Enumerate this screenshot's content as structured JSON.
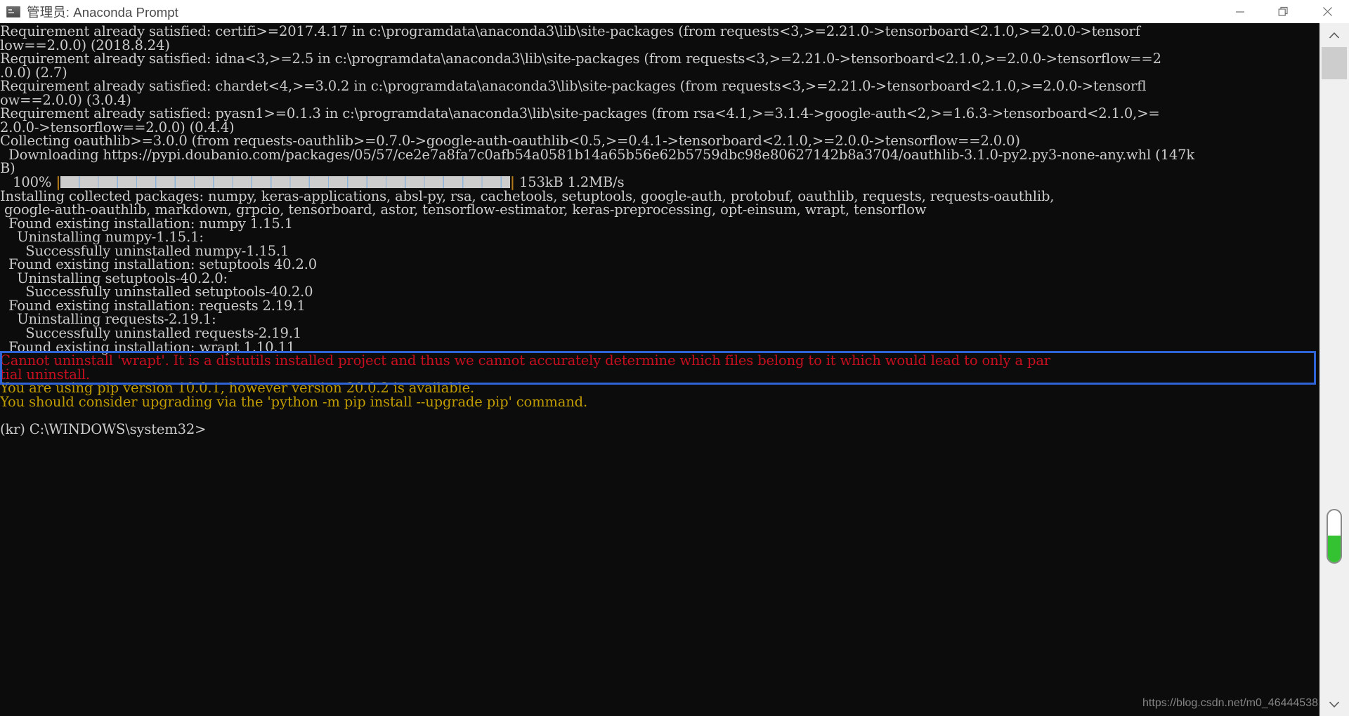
{
  "window": {
    "title": "管理员: Anaconda Prompt",
    "icon": "console-icon",
    "buttons": {
      "minimize": "minimize-icon",
      "maximize": "restore-icon",
      "close": "close-icon"
    }
  },
  "theme": {
    "background": "#0c0c0c",
    "foreground": "#cccccc",
    "red": "#c50f1f",
    "yellow": "#c19c00",
    "annotation": "#2f63d8",
    "scroll_thumb": "#35c232",
    "titlebar_bg": "#ffffff",
    "titlebar_fg": "#4a4a4a"
  },
  "console": {
    "lines": [
      {
        "id": "l01",
        "color": "white",
        "text": "Requirement already satisfied: certifi>=2017.4.17 in c:\\programdata\\anaconda3\\lib\\site-packages (from requests<3,>=2.21.0->tensorboard<2.1.0,>=2.0.0->tensorf"
      },
      {
        "id": "l02",
        "color": "white",
        "text": "low==2.0.0) (2018.8.24)"
      },
      {
        "id": "l03",
        "color": "white",
        "text": "Requirement already satisfied: idna<3,>=2.5 in c:\\programdata\\anaconda3\\lib\\site-packages (from requests<3,>=2.21.0->tensorboard<2.1.0,>=2.0.0->tensorflow==2"
      },
      {
        "id": "l04",
        "color": "white",
        "text": ".0.0) (2.7)"
      },
      {
        "id": "l05",
        "color": "white",
        "text": "Requirement already satisfied: chardet<4,>=3.0.2 in c:\\programdata\\anaconda3\\lib\\site-packages (from requests<3,>=2.21.0->tensorboard<2.1.0,>=2.0.0->tensorfl"
      },
      {
        "id": "l06",
        "color": "white",
        "text": "ow==2.0.0) (3.0.4)"
      },
      {
        "id": "l07",
        "color": "white",
        "text": "Requirement already satisfied: pyasn1>=0.1.3 in c:\\programdata\\anaconda3\\lib\\site-packages (from rsa<4.1,>=3.1.4->google-auth<2,>=1.6.3->tensorboard<2.1.0,>="
      },
      {
        "id": "l08",
        "color": "white",
        "text": "2.0.0->tensorflow==2.0.0) (0.4.4)"
      },
      {
        "id": "l09",
        "color": "white",
        "text": "Collecting oauthlib>=3.0.0 (from requests-oauthlib>=0.7.0->google-auth-oauthlib<0.5,>=0.4.1->tensorboard<2.1.0,>=2.0.0->tensorflow==2.0.0)"
      },
      {
        "id": "l10",
        "color": "white",
        "text": "  Downloading https://pypi.doubanio.com/packages/05/57/ce2e7a8fa7c0afb54a0581b14a65b56e62b5759dbc98e80627142b8a3704/oauthlib-3.1.0-py2.py3-none-any.whl (147k"
      },
      {
        "id": "l11",
        "color": "white",
        "text": "B)"
      },
      {
        "id": "l12",
        "color": "progress",
        "text": ""
      },
      {
        "id": "l13",
        "color": "white",
        "text": "Installing collected packages: numpy, keras-applications, absl-py, rsa, cachetools, setuptools, google-auth, protobuf, oauthlib, requests, requests-oauthlib,"
      },
      {
        "id": "l14",
        "color": "white",
        "text": " google-auth-oauthlib, markdown, grpcio, tensorboard, astor, tensorflow-estimator, keras-preprocessing, opt-einsum, wrapt, tensorflow"
      },
      {
        "id": "l15",
        "color": "white",
        "text": "  Found existing installation: numpy 1.15.1"
      },
      {
        "id": "l16",
        "color": "white",
        "text": "    Uninstalling numpy-1.15.1:"
      },
      {
        "id": "l17",
        "color": "white",
        "text": "      Successfully uninstalled numpy-1.15.1"
      },
      {
        "id": "l18",
        "color": "white",
        "text": "  Found existing installation: setuptools 40.2.0"
      },
      {
        "id": "l19",
        "color": "white",
        "text": "    Uninstalling setuptools-40.2.0:"
      },
      {
        "id": "l20",
        "color": "white",
        "text": "      Successfully uninstalled setuptools-40.2.0"
      },
      {
        "id": "l21",
        "color": "white",
        "text": "  Found existing installation: requests 2.19.1"
      },
      {
        "id": "l22",
        "color": "white",
        "text": "    Uninstalling requests-2.19.1:"
      },
      {
        "id": "l23",
        "color": "white",
        "text": "      Successfully uninstalled requests-2.19.1"
      },
      {
        "id": "l24",
        "color": "white",
        "text": "  Found existing installation: wrapt 1.10.11"
      },
      {
        "id": "l25",
        "color": "red",
        "text": "Cannot uninstall 'wrapt'. It is a distutils installed project and thus we cannot accurately determine which files belong to it which would lead to only a par"
      },
      {
        "id": "l26",
        "color": "red",
        "text": "tial uninstall."
      },
      {
        "id": "l27",
        "color": "yellow",
        "text": "You are using pip version 10.0.1, however version 20.0.2 is available."
      },
      {
        "id": "l28",
        "color": "yellow",
        "text": "You should consider upgrading via the 'python -m pip install --upgrade pip' command."
      },
      {
        "id": "l29",
        "color": "white",
        "text": ""
      },
      {
        "id": "l30",
        "color": "white",
        "text": "(kr) C:\\WINDOWS\\system32>"
      }
    ],
    "progress": {
      "percent_label": "100%",
      "left_delimiter": "|",
      "right_delimiter": "|",
      "size_label": "153kB",
      "rate_label": "1.2MB/s",
      "percent_value": 100,
      "bar_blocks": 26
    },
    "prompt": "(kr) C:\\WINDOWS\\system32>"
  },
  "annotation": {
    "type": "rectangle",
    "color": "#2f63d8",
    "covers_lines": [
      "l25",
      "l26"
    ]
  },
  "scrollbar": {
    "up_arrow": "chevron-up-icon",
    "down_arrow": "chevron-down-icon",
    "thumb_position_percent": 66
  },
  "watermark": {
    "text": "https://blog.csdn.net/m0_46444538"
  }
}
